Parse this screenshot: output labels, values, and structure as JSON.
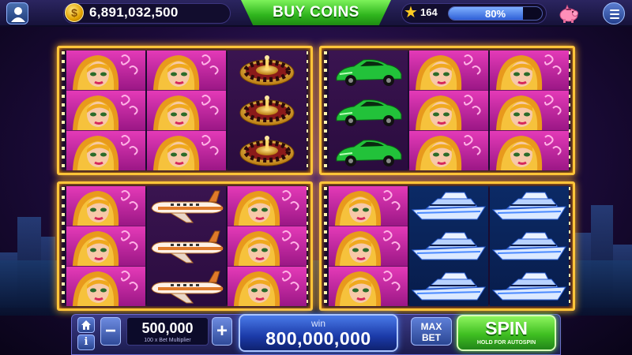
{
  "header": {
    "coins": "6,891,032,500",
    "coin_symbol": "$",
    "buy_coins_label": "BUY COINS",
    "level": "164",
    "xp_percent_label": "80%",
    "xp_progress": 0.8
  },
  "machines": [
    {
      "id": "top-left",
      "reels": [
        "showgirl",
        "showgirl",
        "roulette"
      ]
    },
    {
      "id": "top-right",
      "reels": [
        "sports-car",
        "showgirl",
        "showgirl"
      ]
    },
    {
      "id": "bottom-left",
      "reels": [
        "showgirl",
        "jet",
        "showgirl"
      ]
    },
    {
      "id": "bottom-right",
      "reels": [
        "showgirl",
        "yacht",
        "yacht"
      ]
    }
  ],
  "footer": {
    "home_icon": "home-icon",
    "info_label": "i",
    "minus_label": "−",
    "bet_value": "500,000",
    "bet_sub": "100 x Bet Multiplier",
    "plus_label": "+",
    "win_label": "win",
    "win_value": "800,000,000",
    "max_bet_label_1": "MAX",
    "max_bet_label_2": "BET",
    "spin_label": "SPIN",
    "spin_sub": "HOLD FOR AUTOSPIN"
  },
  "colors": {
    "frame_gold": "#ffc53a",
    "spin_green": "#3fbe21",
    "win_blue": "#1b3aa8",
    "xp_fill": "#2f5fd6"
  }
}
